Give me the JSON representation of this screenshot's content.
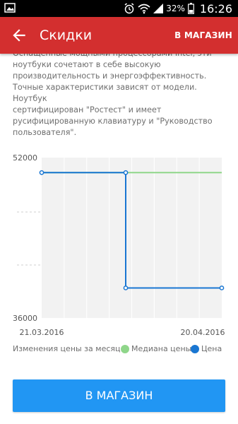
{
  "status_bar": {
    "battery_percent": "32%",
    "time": "16:26",
    "icons": [
      "image-icon",
      "alarm-icon",
      "wifi-icon",
      "signal-icon",
      "battery-icon"
    ]
  },
  "app_bar": {
    "title": "Скидки",
    "shop_button": "В МАГАЗИН"
  },
  "description": {
    "line0": "Оснащенные мощными процессорами Intel, эти",
    "line1": "ноутбуки сочетают в себе высокую",
    "line2": "производительность и энергоэффективность.",
    "line3": "Точные характеристики зависят от модели.  Ноутбук",
    "line4": "сертифицирован \"Ростест\" и имеет",
    "line5": "русифицированную клавиатуру и \"Руководство",
    "line6": "пользователя\"."
  },
  "chart_data": {
    "type": "line",
    "ylim": [
      36000,
      52000
    ],
    "y_ticks": [
      "52000",
      "36000"
    ],
    "x_tick_labels": [
      "21.03.2016",
      "20.04.2016"
    ],
    "series": [
      {
        "name": "Медиана цены",
        "color": "#8fd68a",
        "points": [
          [
            "2016-03-21",
            50500
          ],
          [
            "2016-04-20",
            50500
          ]
        ]
      },
      {
        "name": "Цена",
        "color": "#1976d2",
        "points": [
          [
            "2016-03-21",
            50500
          ],
          [
            "2016-04-04",
            50500
          ],
          [
            "2016-04-04",
            39000
          ],
          [
            "2016-04-20",
            39000
          ]
        ]
      }
    ]
  },
  "legend": {
    "caption": "Изменения цены за месяц",
    "median_label": "Медиана цены",
    "price_label": "Цена"
  },
  "colors": {
    "app_bar": "#d32f2f",
    "cta": "#2196f3",
    "median": "#8fd68a",
    "price": "#1976d2"
  },
  "cta_button": "В МАГАЗИН"
}
